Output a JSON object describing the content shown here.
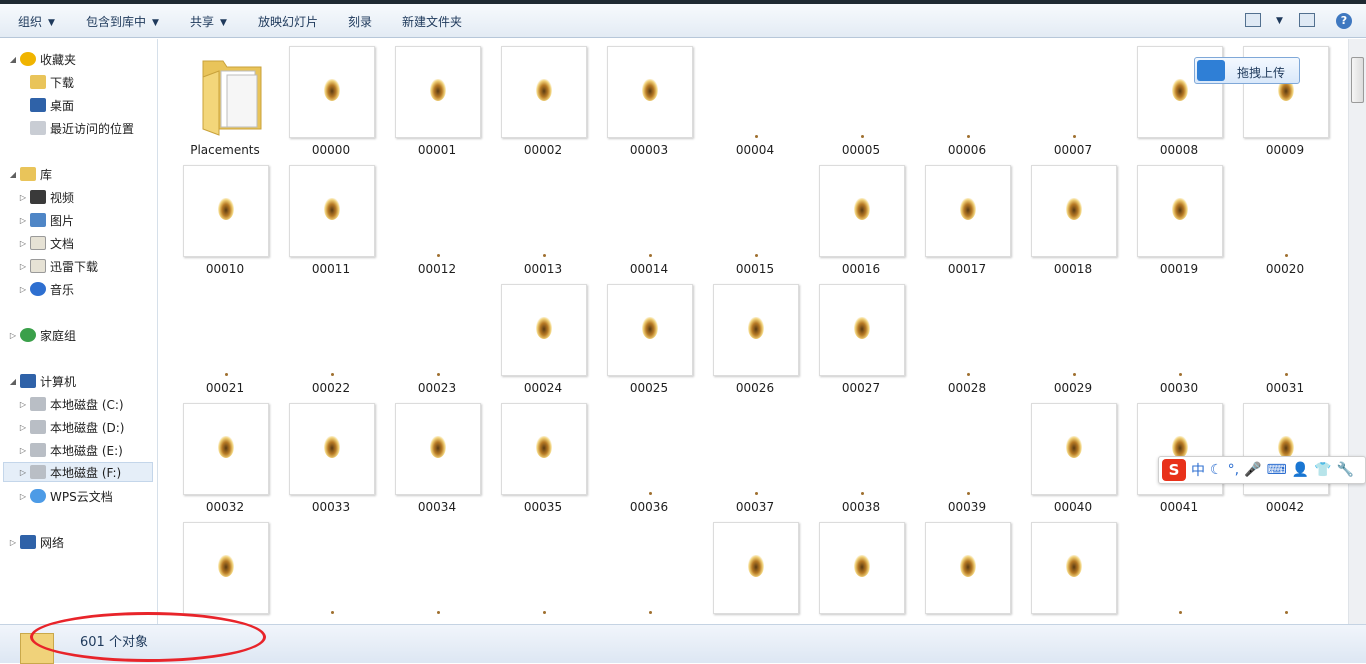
{
  "toolbar": {
    "organize": "组织",
    "include_in_library": "包含到库中",
    "share": "共享",
    "slideshow": "放映幻灯片",
    "burn": "刻录",
    "new_folder": "新建文件夹",
    "help": "?"
  },
  "nav": {
    "favorites": "收藏夹",
    "downloads": "下载",
    "desktop": "桌面",
    "recent": "最近访问的位置",
    "libraries": "库",
    "videos": "视频",
    "pictures": "图片",
    "documents": "文档",
    "thunder": "迅雷下载",
    "music": "音乐",
    "homegroup": "家庭组",
    "computer": "计算机",
    "drive_c": "本地磁盘 (C:)",
    "drive_d": "本地磁盘 (D:)",
    "drive_e": "本地磁盘 (E:)",
    "drive_f": "本地磁盘 (F:)",
    "wps_cloud": "WPS云文档",
    "network": "网络"
  },
  "files": {
    "folder": "Placements",
    "items": [
      {
        "name": "00000",
        "thumb": true
      },
      {
        "name": "00001",
        "thumb": true
      },
      {
        "name": "00002",
        "thumb": true
      },
      {
        "name": "00003",
        "thumb": true
      },
      {
        "name": "00004",
        "thumb": false
      },
      {
        "name": "00005",
        "thumb": false
      },
      {
        "name": "00006",
        "thumb": false
      },
      {
        "name": "00007",
        "thumb": false
      },
      {
        "name": "00008",
        "thumb": true
      },
      {
        "name": "00009",
        "thumb": true
      },
      {
        "name": "00010",
        "thumb": true
      },
      {
        "name": "00011",
        "thumb": true
      },
      {
        "name": "00012",
        "thumb": false
      },
      {
        "name": "00013",
        "thumb": false
      },
      {
        "name": "00014",
        "thumb": false
      },
      {
        "name": "00015",
        "thumb": false
      },
      {
        "name": "00016",
        "thumb": true
      },
      {
        "name": "00017",
        "thumb": true
      },
      {
        "name": "00018",
        "thumb": true
      },
      {
        "name": "00019",
        "thumb": true
      },
      {
        "name": "00020",
        "thumb": false
      },
      {
        "name": "00021",
        "thumb": false
      },
      {
        "name": "00022",
        "thumb": false
      },
      {
        "name": "00023",
        "thumb": false
      },
      {
        "name": "00024",
        "thumb": true
      },
      {
        "name": "00025",
        "thumb": true
      },
      {
        "name": "00026",
        "thumb": true
      },
      {
        "name": "00027",
        "thumb": true
      },
      {
        "name": "00028",
        "thumb": false
      },
      {
        "name": "00029",
        "thumb": false
      },
      {
        "name": "00030",
        "thumb": false
      },
      {
        "name": "00031",
        "thumb": false
      },
      {
        "name": "00032",
        "thumb": true
      },
      {
        "name": "00033",
        "thumb": true
      },
      {
        "name": "00034",
        "thumb": true
      },
      {
        "name": "00035",
        "thumb": true
      },
      {
        "name": "00036",
        "thumb": false
      },
      {
        "name": "00037",
        "thumb": false
      },
      {
        "name": "00038",
        "thumb": false
      },
      {
        "name": "00039",
        "thumb": false
      },
      {
        "name": "00040",
        "thumb": true
      },
      {
        "name": "00041",
        "thumb": true
      },
      {
        "name": "00042",
        "thumb": true
      },
      {
        "name": "",
        "thumb": true
      },
      {
        "name": "",
        "thumb": false
      },
      {
        "name": "",
        "thumb": false
      },
      {
        "name": "",
        "thumb": false
      },
      {
        "name": "",
        "thumb": false
      },
      {
        "name": "",
        "thumb": true
      },
      {
        "name": "",
        "thumb": true
      },
      {
        "name": "",
        "thumb": true
      },
      {
        "name": "",
        "thumb": true
      },
      {
        "name": "",
        "thumb": false
      },
      {
        "name": "",
        "thumb": false
      }
    ]
  },
  "status": {
    "count": "601 个对象"
  },
  "upload_button": "拖拽上传",
  "ime": {
    "mode": "中"
  },
  "colors": {
    "accent": "#1e395b",
    "highlight_ellipse": "#e8242a",
    "ime_logo": "#e8311a"
  }
}
